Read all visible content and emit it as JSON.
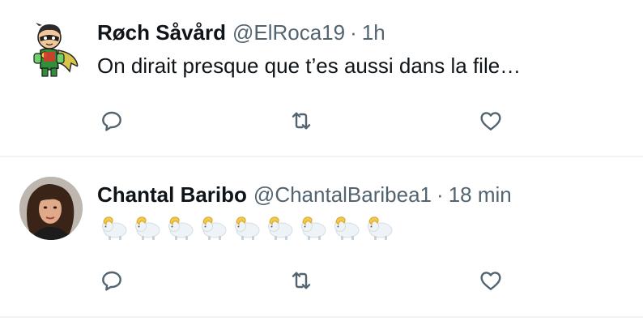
{
  "tweets": [
    {
      "author_name": "Røch Såvård",
      "handle": "@ElRoca19",
      "separator": "·",
      "time": "1h",
      "text": "On dirait presque que t’es aussi dans la file…",
      "avatar_icon": "robin-cartoon-avatar"
    },
    {
      "author_name": "Chantal Baribo",
      "handle": "@ChantalBaribea1",
      "separator": "·",
      "time": "18 min",
      "emoji": [
        "ram-emoji",
        "ram-emoji",
        "ram-emoji",
        "ram-emoji",
        "ram-emoji",
        "ram-emoji",
        "ram-emoji",
        "ram-emoji",
        "ram-emoji"
      ],
      "avatar_icon": "profile-photo-avatar"
    }
  ],
  "actions": [
    "reply-icon",
    "retweet-icon",
    "like-icon"
  ],
  "colors": {
    "text_primary": "#0f1419",
    "text_secondary": "#536471",
    "divider": "#eff3f4",
    "icon": "#536471"
  }
}
